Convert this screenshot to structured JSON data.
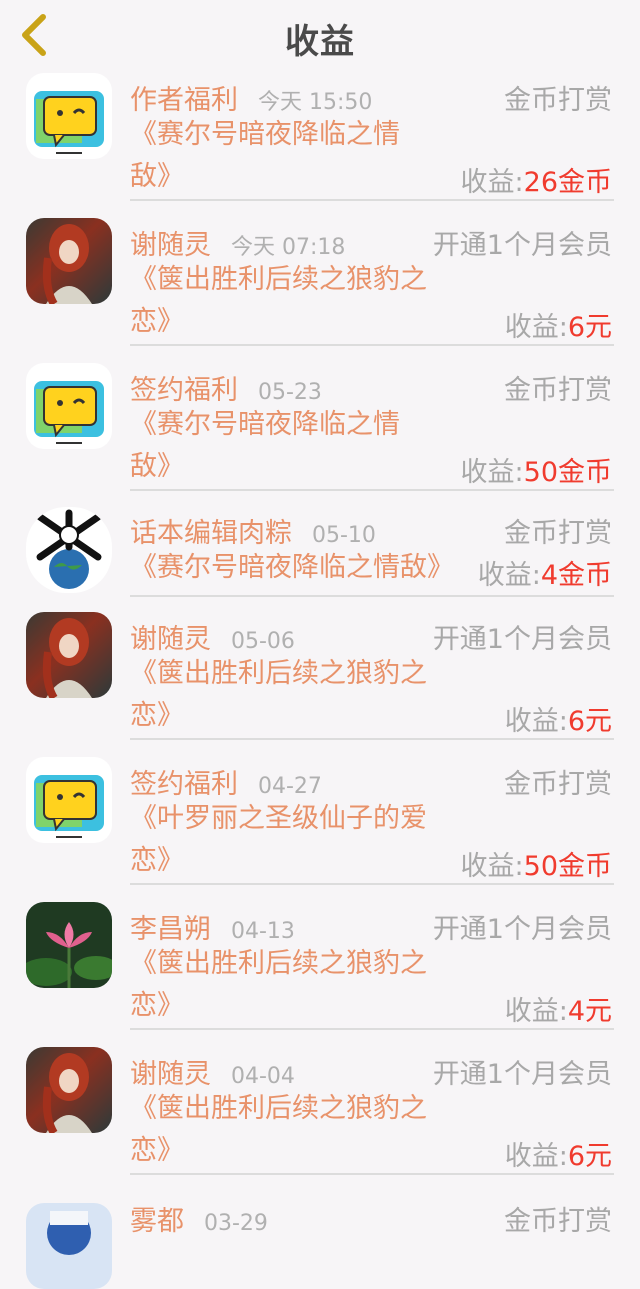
{
  "header": {
    "title": "收益"
  },
  "colors": {
    "author": "#e8926a",
    "amount": "#f03b2e",
    "muted": "#a8a8a8"
  },
  "items": [
    {
      "author": "作者福利",
      "time": "今天 15:50",
      "type": "金币打赏",
      "book": "《赛尔号暗夜降临之情敌》",
      "income_label": "收益:",
      "amount": "26金币",
      "avatar": "yellow-chat-logo"
    },
    {
      "author": "谢随灵",
      "time": "今天 07:18",
      "type": "开通1个月会员",
      "book": "《箧出胜利后续之狼豹之恋》",
      "income_label": "收益:",
      "amount": "6元",
      "avatar": "red-hair-girl"
    },
    {
      "author": "签约福利",
      "time": "05-23",
      "type": "金币打赏",
      "book": "《赛尔号暗夜降临之情敌》",
      "income_label": "收益:",
      "amount": "50金币",
      "avatar": "yellow-chat-logo"
    },
    {
      "author": "话本编辑肉粽",
      "time": "05-10",
      "type": "金币打赏",
      "book": "《赛尔号暗夜降临之情敌》",
      "income_label": "收益:",
      "amount": "4金币",
      "avatar": "bones-globe"
    },
    {
      "author": "谢随灵",
      "time": "05-06",
      "type": "开通1个月会员",
      "book": "《箧出胜利后续之狼豹之恋》",
      "income_label": "收益:",
      "amount": "6元",
      "avatar": "red-hair-girl"
    },
    {
      "author": "签约福利",
      "time": "04-27",
      "type": "金币打赏",
      "book": "《叶罗丽之圣级仙子的爱恋》",
      "income_label": "收益:",
      "amount": "50金币",
      "avatar": "yellow-chat-logo"
    },
    {
      "author": "李昌朔",
      "time": "04-13",
      "type": "开通1个月会员",
      "book": "《箧出胜利后续之狼豹之恋》",
      "income_label": "收益:",
      "amount": "4元",
      "avatar": "pink-lotus"
    },
    {
      "author": "谢随灵",
      "time": "04-04",
      "type": "开通1个月会员",
      "book": "《箧出胜利后续之狼豹之恋》",
      "income_label": "收益:",
      "amount": "6元",
      "avatar": "red-hair-girl"
    },
    {
      "author": "雾都",
      "time": "03-29",
      "type": "金币打赏",
      "avatar": "blue-character"
    }
  ]
}
